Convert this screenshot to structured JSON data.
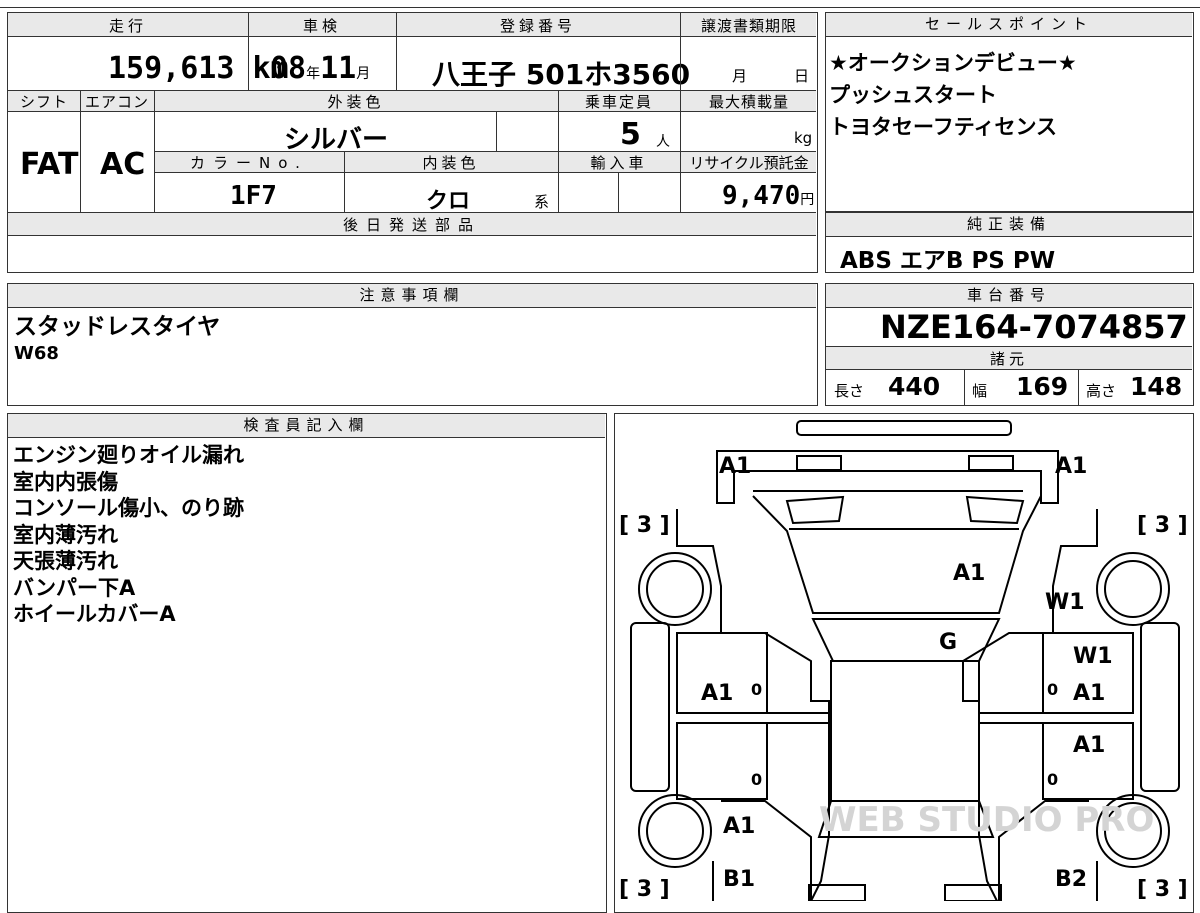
{
  "labels": {
    "mileage": "走行",
    "inspection": "車検",
    "registration": "登録番号",
    "transfer_deadline": "譲渡書類期限",
    "sales_points": "セールスポイント",
    "shift": "シフト",
    "aircon": "エアコン",
    "exterior_color": "外装色",
    "capacity": "乗車定員",
    "max_load": "最大積載量",
    "color_no": "カラーNo.",
    "interior_color": "内装色",
    "import": "輸入車",
    "recycle_fee": "リサイクル預託金",
    "later_parts": "後日発送部品",
    "genuine_equipment": "純正装備",
    "notes": "注意事項欄",
    "chassis_number": "車台番号",
    "specs": "諸元",
    "inspector_notes": "検査員記入欄",
    "length": "長さ",
    "width": "幅",
    "height": "高さ"
  },
  "vehicle": {
    "mileage": "159,613",
    "mileage_unit": "km",
    "inspection_year": "08",
    "year_unit": "年",
    "inspection_month": "11",
    "month_unit": "月",
    "registration": "八王子 501ホ3560",
    "deadline_month_unit": "月",
    "deadline_day_unit": "日",
    "shift": "FAT",
    "aircon": "AC",
    "exterior_color": "シルバー",
    "capacity": "5",
    "capacity_unit": "人",
    "max_load_unit": "kg",
    "color_no": "1F7",
    "interior_color": "クロ",
    "interior_suffix": "系",
    "recycle_fee": "9,470",
    "recycle_unit": "円",
    "chassis_number": "NZE164-7074857",
    "length": "440",
    "width": "169",
    "height": "148"
  },
  "sales_points": [
    "★オークションデビュー★",
    "プッシュスタート",
    "トヨタセーフティセンス"
  ],
  "genuine_equipment": "ABS エアB PS PW",
  "notes": [
    "スタッドレスタイヤ",
    "W68"
  ],
  "inspector_notes": [
    "エンジン廻りオイル漏れ",
    "室内内張傷",
    "コンソール傷小、のり跡",
    "室内薄汚れ",
    "天張薄汚れ",
    "バンパー下A",
    "ホイールカバーA"
  ],
  "diagram": {
    "tire_tread": "[ 3 ]",
    "marks": {
      "front_left": "A1",
      "front_right": "A1",
      "hood": "A1",
      "right_fender": "W1",
      "windshield": "G",
      "right_front_door_upper": "W1",
      "left_front_door": "A1",
      "right_front_door": "A1",
      "right_rear_door": "A1",
      "left_rear_fender": "A1",
      "rear_left": "B1",
      "rear_right": "B2",
      "zero": "0"
    }
  },
  "watermark": "WEB STUDIO PRO"
}
